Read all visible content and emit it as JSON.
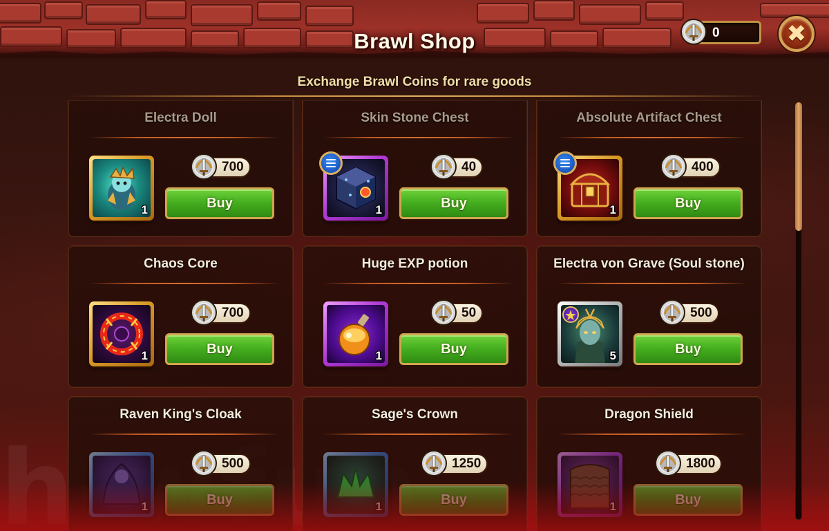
{
  "header": {
    "title": "Brawl Shop",
    "coins": "0",
    "close_icon": "close-icon"
  },
  "subtitle": "Exchange Brawl Coins for rare goods",
  "colors": {
    "buy_green": "#46b020",
    "frame_gold": "#d89a25",
    "frame_purple": "#b13ad6",
    "frame_blue": "#3a7ad6",
    "accent_gold": "#c8903f"
  },
  "items": [
    {
      "name": "Electra Doll",
      "price": "700",
      "qty": "1",
      "buy_label": "Buy",
      "frame": "gold",
      "icon": "electra-doll-icon",
      "info": false
    },
    {
      "name": "Skin Stone Chest",
      "price": "40",
      "qty": "1",
      "buy_label": "Buy",
      "frame": "purple",
      "icon": "skin-stone-chest-icon",
      "info": true
    },
    {
      "name": "Absolute Artifact Chest",
      "price": "400",
      "qty": "1",
      "buy_label": "Buy",
      "frame": "gold",
      "icon": "artifact-chest-icon",
      "info": true
    },
    {
      "name": "Chaos Core",
      "price": "700",
      "qty": "1",
      "buy_label": "Buy",
      "frame": "gold",
      "icon": "chaos-core-icon",
      "info": false
    },
    {
      "name": "Huge EXP potion",
      "price": "50",
      "qty": "1",
      "buy_label": "Buy",
      "frame": "purple",
      "icon": "exp-potion-icon",
      "info": false
    },
    {
      "name": "Electra von Grave (Soul stone)",
      "price": "500",
      "qty": "5",
      "buy_label": "Buy",
      "frame": "silver",
      "icon": "soul-stone-icon",
      "info": false
    },
    {
      "name": "Raven King's Cloak",
      "price": "500",
      "qty": "1",
      "buy_label": "Buy",
      "frame": "blue",
      "icon": "cloak-icon",
      "info": false
    },
    {
      "name": "Sage's Crown",
      "price": "1250",
      "qty": "1",
      "buy_label": "Buy",
      "frame": "blue",
      "icon": "crown-icon",
      "info": false
    },
    {
      "name": "Dragon Shield",
      "price": "1800",
      "qty": "1",
      "buy_label": "Buy",
      "frame": "purple",
      "icon": "dragon-shield-icon",
      "info": false
    }
  ]
}
